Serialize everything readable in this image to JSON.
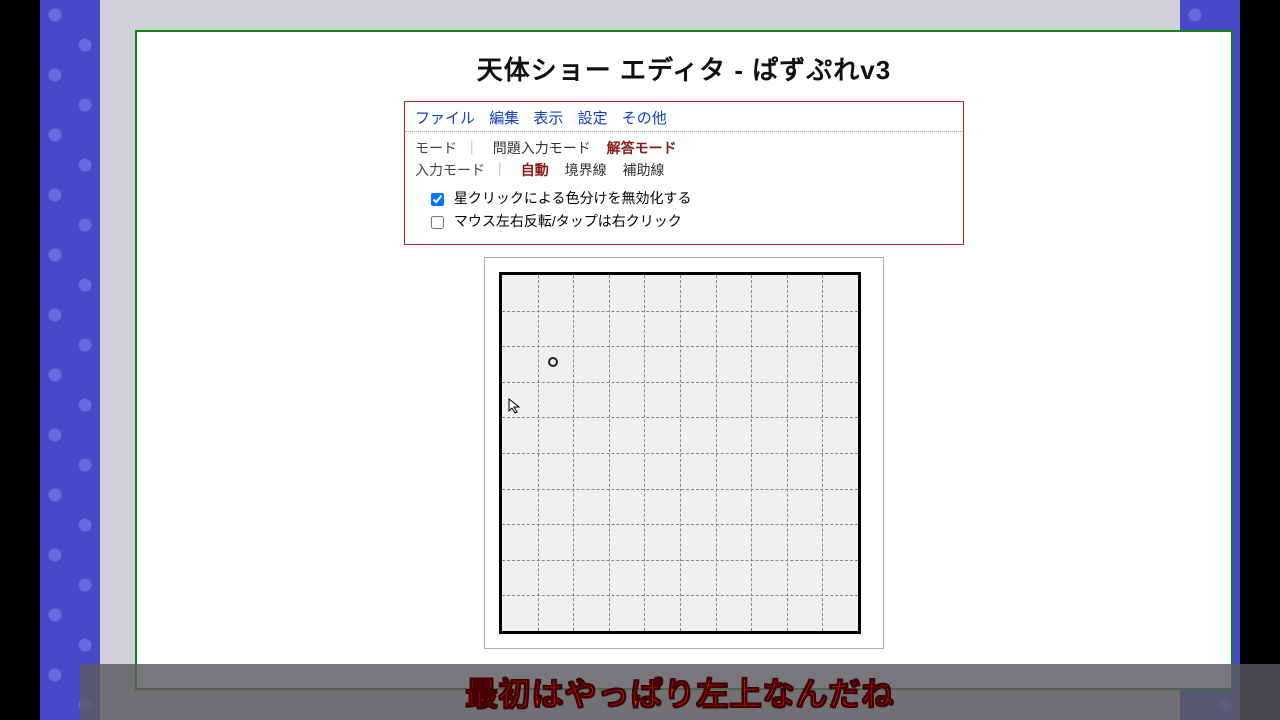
{
  "title": "天体ショー エディタ - ぱずぷれv3",
  "menu": [
    "ファイル",
    "編集",
    "表示",
    "設定",
    "その他"
  ],
  "mode": {
    "label": "モード",
    "options": [
      "問題入力モード",
      "解答モード"
    ],
    "active_index": 1
  },
  "input_mode": {
    "label": "入力モード",
    "options": [
      "自動",
      "境界線",
      "補助線"
    ],
    "active_index": 0
  },
  "checkboxes": [
    {
      "label": "星クリックによる色分けを無効化する",
      "checked": true
    },
    {
      "label": "マウス左右反転/タップは右クリック",
      "checked": false
    }
  ],
  "board": {
    "cols": 10,
    "rows": 10,
    "star_cell": {
      "col": 1,
      "row": 2
    },
    "cursor_cell": {
      "col": 0,
      "row": 3
    }
  },
  "subtitle": "最初はやっぱり左上なんだね"
}
